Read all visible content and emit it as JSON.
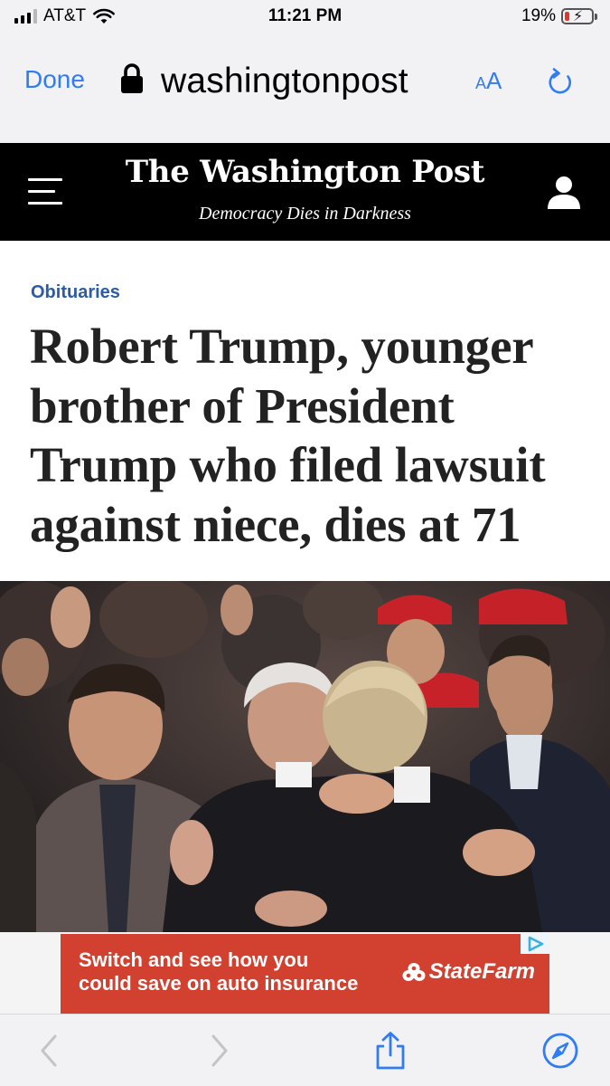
{
  "status_bar": {
    "carrier": "AT&T",
    "time": "11:21 PM",
    "battery_percent": "19%",
    "battery_level": 0.19,
    "icons": [
      "cellular-signal-icon",
      "wifi-icon",
      "battery-charging-icon"
    ]
  },
  "browser": {
    "done_label": "Done",
    "url": "washingtonpost",
    "text_size_label_small": "A",
    "text_size_label_large": "A",
    "icons": [
      "lock-icon",
      "reload-icon"
    ]
  },
  "masthead": {
    "logo": "The Washington Post",
    "tagline": "Democracy Dies in Darkness",
    "icons": [
      "hamburger-menu-icon",
      "account-icon"
    ]
  },
  "article": {
    "section": "Obituaries",
    "headline": "Robert Trump, younger brother of President Trump who filed lawsuit against niece, dies at 71"
  },
  "ad": {
    "text_line1": "Switch and see how you",
    "text_line2": "could save on auto insurance",
    "brand": "StateFarm",
    "icons": [
      "adchoices-icon",
      "state-farm-logo-icon"
    ]
  },
  "toolbar": {
    "icons": [
      "back-icon",
      "forward-icon",
      "share-icon",
      "compass-icon"
    ]
  },
  "colors": {
    "ios_blue": "#2f7cf6",
    "kicker_blue": "#2a5ca8",
    "ad_red": "#d2402f",
    "masthead_black": "#000000",
    "chrome_gray": "#f2f2f4"
  }
}
